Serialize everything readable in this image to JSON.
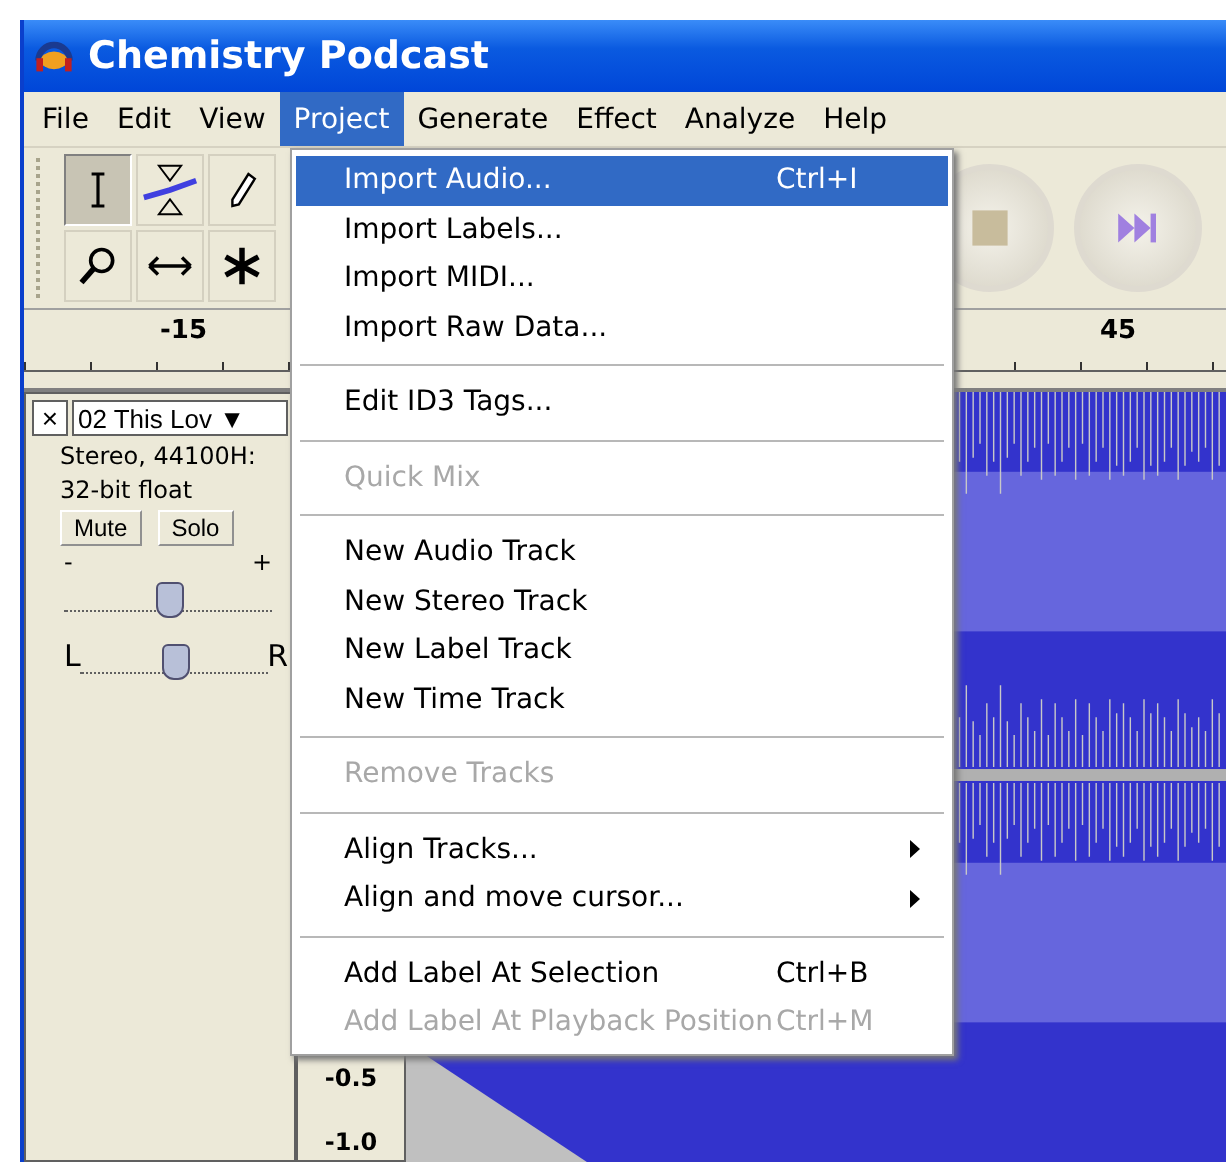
{
  "window": {
    "title": "Chemistry Podcast"
  },
  "menu_bar": [
    {
      "label": "File",
      "selected": false
    },
    {
      "label": "Edit",
      "selected": false
    },
    {
      "label": "View",
      "selected": false
    },
    {
      "label": "Project",
      "selected": true
    },
    {
      "label": "Generate",
      "selected": false
    },
    {
      "label": "Effect",
      "selected": false
    },
    {
      "label": "Analyze",
      "selected": false
    },
    {
      "label": "Help",
      "selected": false
    }
  ],
  "tools": [
    {
      "kind": "select",
      "selected": true
    },
    {
      "kind": "envelope",
      "selected": false
    },
    {
      "kind": "draw",
      "selected": false
    },
    {
      "kind": "zoom",
      "selected": false
    },
    {
      "kind": "timeshift",
      "selected": false
    },
    {
      "kind": "multi",
      "selected": false
    }
  ],
  "timeline": {
    "labels": [
      "-15",
      "45"
    ]
  },
  "project_menu": [
    {
      "kind": "item",
      "label": "Import Audio...",
      "shortcut": "Ctrl+I",
      "selected": true,
      "disabled": false
    },
    {
      "kind": "item",
      "label": "Import Labels...",
      "selected": false,
      "disabled": false
    },
    {
      "kind": "item",
      "label": "Import MIDI...",
      "selected": false,
      "disabled": false
    },
    {
      "kind": "item",
      "label": "Import Raw Data...",
      "selected": false,
      "disabled": false
    },
    {
      "kind": "separator"
    },
    {
      "kind": "item",
      "label": "Edit ID3 Tags...",
      "selected": false,
      "disabled": false
    },
    {
      "kind": "separator"
    },
    {
      "kind": "item",
      "label": "Quick Mix",
      "selected": false,
      "disabled": true
    },
    {
      "kind": "separator"
    },
    {
      "kind": "item",
      "label": "New Audio Track",
      "selected": false,
      "disabled": false
    },
    {
      "kind": "item",
      "label": "New Stereo Track",
      "selected": false,
      "disabled": false
    },
    {
      "kind": "item",
      "label": "New Label Track",
      "selected": false,
      "disabled": false
    },
    {
      "kind": "item",
      "label": "New Time Track",
      "selected": false,
      "disabled": false
    },
    {
      "kind": "separator"
    },
    {
      "kind": "item",
      "label": "Remove Tracks",
      "selected": false,
      "disabled": true
    },
    {
      "kind": "separator"
    },
    {
      "kind": "submenu",
      "label": "Align Tracks...",
      "selected": false,
      "disabled": false
    },
    {
      "kind": "submenu",
      "label": "Align and move cursor...",
      "selected": false,
      "disabled": false
    },
    {
      "kind": "separator"
    },
    {
      "kind": "item",
      "label": "Add Label At Selection",
      "shortcut": "Ctrl+B",
      "selected": false,
      "disabled": false
    },
    {
      "kind": "item",
      "label": "Add Label At Playback Position",
      "shortcut": "Ctrl+M",
      "selected": false,
      "disabled": true
    }
  ],
  "track": {
    "close": "×",
    "name": "02 This Lov",
    "dropdown": "▼",
    "format": "Stereo, 44100H:",
    "sample": "32-bit float",
    "buttons": [
      "Mute",
      "Solo"
    ],
    "gain": {
      "min": "-",
      "max": "+",
      "level": 0.5
    },
    "pan": {
      "min": "L",
      "max": "R",
      "level": 0.5
    }
  },
  "amplitude_ruler": {
    "labels": [
      "-0.5",
      "-1.0"
    ]
  }
}
